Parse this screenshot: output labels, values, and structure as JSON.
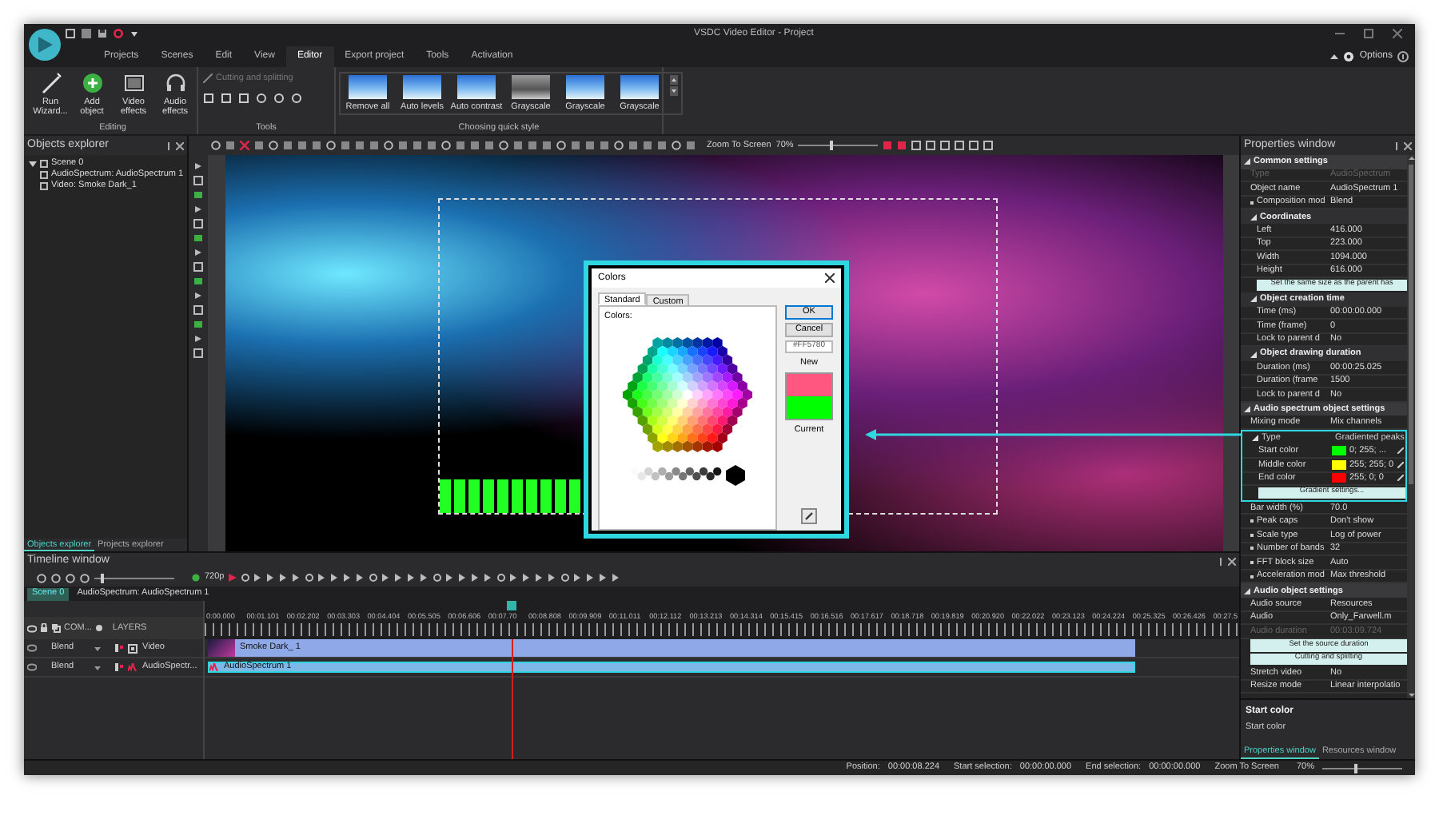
{
  "window": {
    "title": "VSDC Video Editor - Project",
    "options": "Options"
  },
  "menu_tabs": [
    {
      "label": "Projects",
      "selected": false
    },
    {
      "label": "Scenes",
      "selected": false
    },
    {
      "label": "Edit",
      "selected": false
    },
    {
      "label": "View",
      "selected": false
    },
    {
      "label": "Editor",
      "selected": true
    },
    {
      "label": "Export project",
      "selected": false
    },
    {
      "label": "Tools",
      "selected": false
    },
    {
      "label": "Activation",
      "selected": false
    }
  ],
  "ribbon": {
    "editing": {
      "title": "Editing",
      "buttons": [
        "Run Wizard...",
        "Add object",
        "Video effects",
        "Audio effects"
      ]
    },
    "tools": {
      "title": "Tools",
      "command": "Cutting and splitting",
      "disabled": true
    },
    "quick_style": {
      "title": "Choosing quick style",
      "items": [
        {
          "label": "Remove all"
        },
        {
          "label": "Auto levels"
        },
        {
          "label": "Auto contrast"
        },
        {
          "label": "Grayscale"
        },
        {
          "label": "Grayscale"
        },
        {
          "label": "Grayscale"
        }
      ]
    }
  },
  "explorer": {
    "title": "Objects explorer",
    "tree": [
      {
        "label": "Scene 0",
        "expanded": true,
        "children": [
          {
            "label": "AudioSpectrum: AudioSpectrum 1"
          },
          {
            "label": "Video: Smoke Dark_1"
          }
        ]
      }
    ],
    "tabs": [
      {
        "label": "Objects explorer",
        "selected": true
      },
      {
        "label": "Projects explorer",
        "selected": false
      }
    ]
  },
  "canvas_toolbar": {
    "zoom_label": "Zoom To Screen",
    "zoom_value": "70%"
  },
  "colors_dialog": {
    "title": "Colors",
    "tabs": [
      {
        "label": "Standard",
        "selected": true
      },
      {
        "label": "Custom",
        "selected": false
      }
    ],
    "colors_label": "Colors:",
    "ok": "OK",
    "cancel": "Cancel",
    "hex": "#FF5780",
    "swatches": [
      {
        "label": "New",
        "color": "#ff5780"
      },
      {
        "label": "Current",
        "color": "#00ff00"
      }
    ]
  },
  "properties": {
    "title": "Properties window",
    "items": [
      {
        "kind": "group",
        "label": "Common settings",
        "children": [
          {
            "kind": "row",
            "label": "Type",
            "value": "AudioSpectrum",
            "disabled": true
          },
          {
            "kind": "row",
            "label": "Object name",
            "value": "AudioSpectrum 1",
            "disabled": false
          },
          {
            "kind": "row",
            "label": "Composition mod",
            "value": "Blend",
            "disabled": false,
            "collapsed": true
          },
          {
            "kind": "group",
            "label": "Coordinates",
            "children": [
              {
                "kind": "row",
                "label": "Left",
                "value": "416.000",
                "disabled": false
              },
              {
                "kind": "row",
                "label": "Top",
                "value": "223.000",
                "disabled": false
              },
              {
                "kind": "row",
                "label": "Width",
                "value": "1094.000",
                "disabled": false
              },
              {
                "kind": "row",
                "label": "Height",
                "value": "616.000",
                "disabled": false
              },
              {
                "kind": "button",
                "label": "Set the same size as the parent has"
              }
            ]
          },
          {
            "kind": "group",
            "label": "Object creation time",
            "children": [
              {
                "kind": "row",
                "label": "Time (ms)",
                "value": "00:00:00.000",
                "disabled": false
              },
              {
                "kind": "row",
                "label": "Time (frame)",
                "value": "0",
                "disabled": false
              },
              {
                "kind": "row",
                "label": "Lock to parent d",
                "value": "No",
                "disabled": false
              }
            ]
          },
          {
            "kind": "group",
            "label": "Object drawing duration",
            "children": [
              {
                "kind": "row",
                "label": "Duration (ms)",
                "value": "00:00:25.025",
                "disabled": false
              },
              {
                "kind": "row",
                "label": "Duration (frame",
                "value": "1500",
                "disabled": false
              },
              {
                "kind": "row",
                "label": "Lock to parent d",
                "value": "No",
                "disabled": false
              }
            ]
          }
        ]
      },
      {
        "kind": "group",
        "label": "Audio spectrum object settings",
        "children": [
          {
            "kind": "row",
            "label": "Mixing mode",
            "value": "Mix channels",
            "disabled": false
          },
          {
            "kind": "group",
            "label": "Type",
            "value": "Gradiented peaks",
            "highlighted": true,
            "children": [
              {
                "kind": "color",
                "label": "Start color",
                "value": "0; 255; ...",
                "color": "#00ff00"
              },
              {
                "kind": "color",
                "label": "Middle color",
                "value": "255; 255; 0",
                "color": "#ffff00"
              },
              {
                "kind": "color",
                "label": "End color",
                "value": "255; 0; 0",
                "color": "#ff0000"
              },
              {
                "kind": "button",
                "label": "Gradient settings..."
              }
            ]
          },
          {
            "kind": "row",
            "label": "Bar width (%)",
            "value": "70.0",
            "disabled": false
          },
          {
            "kind": "row",
            "label": "Peak caps",
            "value": "Don't show",
            "disabled": false,
            "collapsed": true
          },
          {
            "kind": "row",
            "label": "Scale type",
            "value": "Log of power",
            "disabled": false,
            "collapsed": true
          },
          {
            "kind": "row",
            "label": "Number of bands",
            "value": "32",
            "disabled": false,
            "collapsed": true
          },
          {
            "kind": "row",
            "label": "FFT block size",
            "value": "Auto",
            "disabled": false,
            "collapsed": true
          },
          {
            "kind": "row",
            "label": "Acceleration mod",
            "value": "Max threshold",
            "disabled": false,
            "collapsed": true
          }
        ]
      },
      {
        "kind": "group",
        "label": "Audio object settings",
        "children": [
          {
            "kind": "row",
            "label": "Audio source",
            "value": "Resources",
            "disabled": false
          },
          {
            "kind": "row",
            "label": "Audio",
            "value": "Only_Farwell.m",
            "disabled": false
          },
          {
            "kind": "row",
            "label": "Audio duration",
            "value": "00:03:09.724",
            "disabled": true
          },
          {
            "kind": "button",
            "label": "Set the source duration"
          },
          {
            "kind": "button",
            "label": "Cutting and splitting"
          },
          {
            "kind": "row",
            "label": "Stretch video",
            "value": "No",
            "disabled": false
          },
          {
            "kind": "row",
            "label": "Resize mode",
            "value": "Linear interpolatio",
            "disabled": false
          }
        ]
      }
    ],
    "description_title": "Start color",
    "description": "Start color",
    "tabs": [
      {
        "label": "Properties window",
        "selected": true
      },
      {
        "label": "Resources window",
        "selected": false
      }
    ]
  },
  "timeline": {
    "title": "Timeline window",
    "resolution": "720p",
    "scene_tabs": [
      {
        "label": "Scene 0",
        "selected": true
      },
      {
        "label": "AudioSpectrum: AudioSpectrum 1",
        "selected": false
      }
    ],
    "header": {
      "column_1": "COM...",
      "column_2": "LAYERS"
    },
    "ruler": [
      "0:00.000",
      "00:01.101",
      "00:02.202",
      "00:03.303",
      "00:04.404",
      "00:05.505",
      "00:06.606",
      "00:07.70",
      "00:08.808",
      "00:09.909",
      "00:11.011",
      "00:12.112",
      "00:13.213",
      "00:14.314",
      "00:15.415",
      "00:16.516",
      "00:17.617",
      "00:18.718",
      "00:19.819",
      "00:20.920",
      "00:22.022",
      "00:23.123",
      "00:24.224",
      "00:25.325",
      "00:26.426",
      "00:27.5"
    ],
    "playhead": {
      "level": 0.297
    },
    "tracks": [
      {
        "blend": "Blend",
        "name": "Video",
        "clip": "Smoke Dark_ 1",
        "kind": "video"
      },
      {
        "blend": "Blend",
        "name": "AudioSpectr...",
        "clip": "AudioSpectrum 1",
        "kind": "spectrum"
      }
    ]
  },
  "status_bar": {
    "items": [
      {
        "label": "Position:",
        "value": "00:00:08.224"
      },
      {
        "label": "Start selection:",
        "value": "00:00:00.000"
      },
      {
        "label": "End selection:",
        "value": "00:00:00.000"
      }
    ],
    "zoom_label": "Zoom To Screen",
    "zoom_value": "70%"
  }
}
